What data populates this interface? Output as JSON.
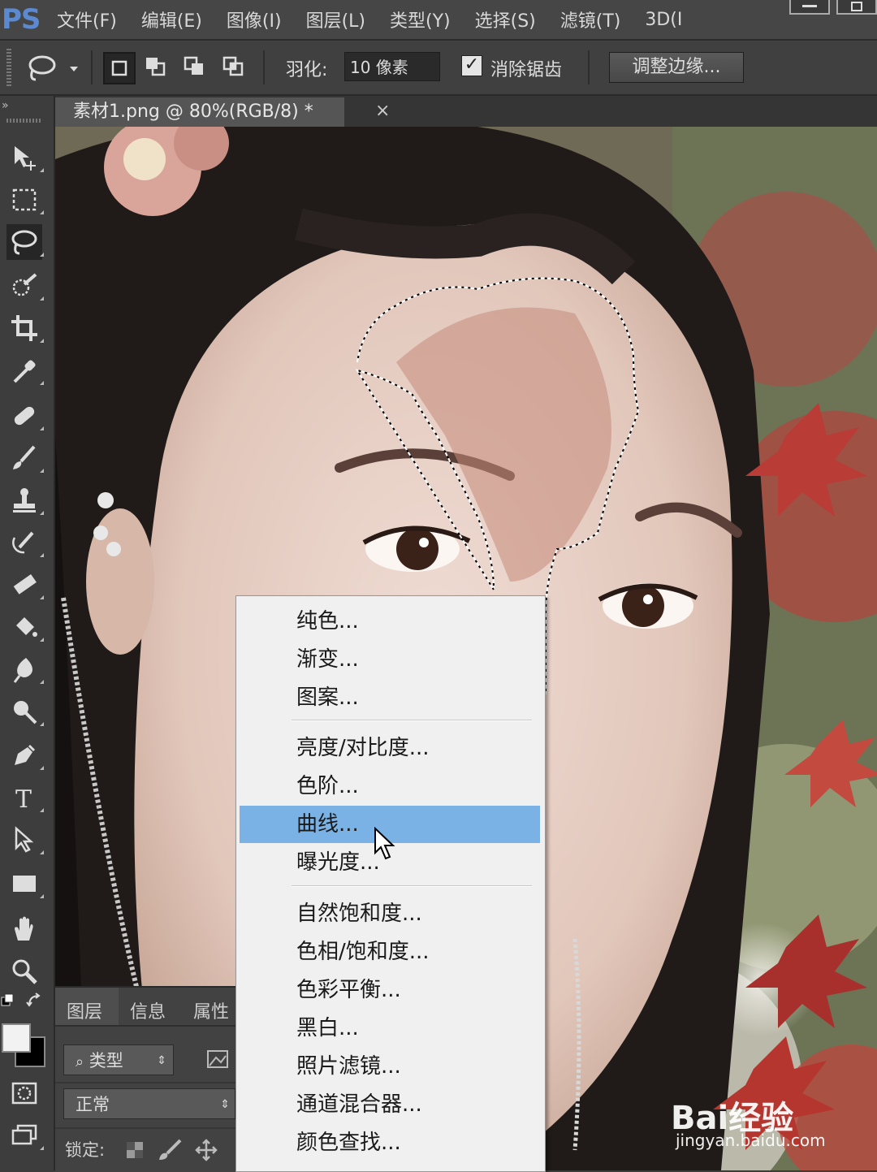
{
  "app": {
    "logo": "PS",
    "menu": [
      "文件(F)",
      "编辑(E)",
      "图像(I)",
      "图层(L)",
      "类型(Y)",
      "选择(S)",
      "滤镜(T)",
      "3D(I"
    ]
  },
  "options_bar": {
    "feather_label": "羽化:",
    "feather_value": "10 像素",
    "antialias_label": "消除锯齿",
    "antialias_checked": true,
    "refine_edge_button": "调整边缘..."
  },
  "document": {
    "tab_title": "素材1.png @ 80%(RGB/8) *",
    "close_glyph": "×"
  },
  "layers_panel": {
    "tabs": [
      "图层",
      "信息",
      "属性"
    ],
    "filter_kind": "类型",
    "blend_mode": "正常",
    "lock_label": "锁定:"
  },
  "context_menu": {
    "groups": [
      [
        "纯色...",
        "渐变...",
        "图案..."
      ],
      [
        "亮度/对比度...",
        "色阶...",
        "曲线...",
        "曝光度..."
      ],
      [
        "自然饱和度...",
        "色相/饱和度...",
        "色彩平衡...",
        "黑白...",
        "照片滤镜...",
        "通道混合器...",
        "颜色查找..."
      ]
    ],
    "highlighted": "曲线..."
  },
  "watermark": {
    "logo": "Bai经验",
    "url": "jingyan.baidu.com"
  },
  "colors": {
    "menu_highlight": "#7ab2e6",
    "ps_blue": "#5b8ad0"
  }
}
